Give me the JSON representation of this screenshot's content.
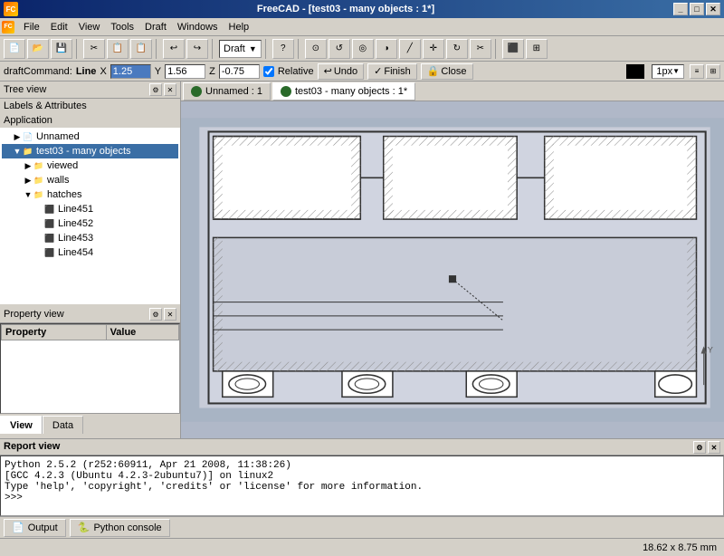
{
  "titlebar": {
    "title": "FreeCAD - [test03 - many objects : 1*]",
    "controls": [
      "_",
      "□",
      "✕"
    ]
  },
  "menubar": {
    "items": [
      "File",
      "Edit",
      "View",
      "Tools",
      "Draft",
      "Windows",
      "Help"
    ]
  },
  "toolbar": {
    "draft_label": "Draft",
    "tools": [
      "new",
      "open",
      "save",
      "cut",
      "copy",
      "paste",
      "undo",
      "redo",
      "draw_point",
      "draw_line",
      "draw_wire",
      "draw_circle",
      "draw_arc",
      "draw_polygon",
      "move",
      "rotate",
      "offset",
      "trim",
      "snap_midpoint",
      "snap_grid"
    ]
  },
  "commandbar": {
    "draft_command_label": "draftCommand:",
    "draft_command_value": "Line",
    "x_label": "X",
    "x_value": "1.25",
    "y_label": "Y",
    "y_value": "1.56",
    "z_label": "Z",
    "z_value": "-0.75",
    "relative_label": "Relative",
    "undo_label": "Undo",
    "finish_label": "Finish",
    "close_label": "Close",
    "line_width_value": "1px"
  },
  "left_panel": {
    "tree_view_label": "Tree view",
    "labels_attributes_label": "Labels & Attributes",
    "application_label": "Application",
    "tree_items": [
      {
        "id": "unnamed",
        "label": "Unnamed",
        "level": 1,
        "type": "file",
        "expanded": false
      },
      {
        "id": "test03",
        "label": "test03 - many objects",
        "level": 1,
        "type": "folder",
        "expanded": true
      },
      {
        "id": "viewed",
        "label": "viewed",
        "level": 2,
        "type": "folder",
        "expanded": false
      },
      {
        "id": "walls",
        "label": "walls",
        "level": 2,
        "type": "folder",
        "expanded": false
      },
      {
        "id": "hatches",
        "label": "hatches",
        "level": 2,
        "type": "folder",
        "expanded": true
      },
      {
        "id": "line451",
        "label": "Line451",
        "level": 3,
        "type": "line",
        "expanded": false
      },
      {
        "id": "line452",
        "label": "Line452",
        "level": 3,
        "type": "line",
        "expanded": false
      },
      {
        "id": "line453",
        "label": "Line453",
        "level": 3,
        "type": "line",
        "expanded": false
      },
      {
        "id": "line454",
        "label": "Line454",
        "level": 3,
        "type": "line",
        "expanded": false
      }
    ],
    "property_view_label": "Property view",
    "property_header": "Property",
    "value_header": "Value",
    "view_tab": "View",
    "data_tab": "Data"
  },
  "canvas": {
    "tabs": [
      {
        "label": "Unnamed : 1",
        "active": false
      },
      {
        "label": "test03 - many objects : 1*",
        "active": true
      }
    ],
    "coordinates": "18.62 x 8.75 mm"
  },
  "report": {
    "header": "Report view",
    "lines": [
      "Python 2.5.2 (r252:60911, Apr 21 2008, 11:38:26)",
      "[GCC 4.2.3 (Ubuntu 4.2.3-2ubuntu7)] on linux2",
      "Type 'help', 'copyright', 'credits' or 'license' for more information.",
      ">>>"
    ],
    "tabs": [
      "Output",
      "Python console"
    ]
  }
}
